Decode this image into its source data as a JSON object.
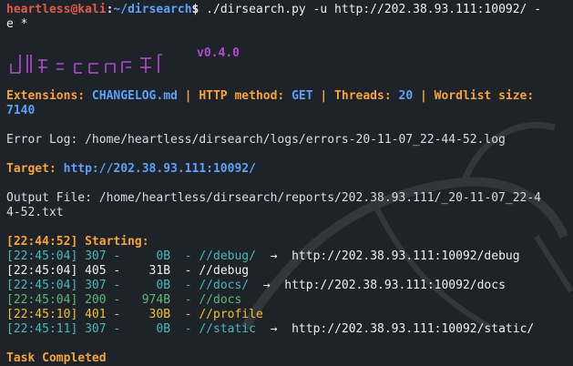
{
  "prompt": {
    "user": "heartless",
    "at": "@",
    "host": "kali",
    "colon": ":",
    "path": "~/dirsearch",
    "symbol": "$",
    "command_part1": " ./dirsearch.py -u http://202.38.93.111:10092/ -",
    "command_part2": "e *"
  },
  "banner": {
    "version": "v0.4.0"
  },
  "config": {
    "ext_label": "Extensions: ",
    "ext_value": "CHANGELOG.md",
    "sep1": " | ",
    "method_label": "HTTP method: ",
    "method_value": "GET",
    "sep2": " | ",
    "threads_label": "Threads: ",
    "threads_value": "20",
    "sep3": " | ",
    "wordlist_label": "Wordlist size:",
    "wordlist_value": "7140"
  },
  "error_log": "Error Log: /home/heartless/dirsearch/logs/errors-20-11-07_22-44-52.log",
  "target": {
    "label": "Target: ",
    "value": "http://202.38.93.111:10092/"
  },
  "output_file": {
    "line1": "Output File: /home/heartless/dirsearch/reports/202.38.93.111/_20-11-07_22-4",
    "line2": "4-52.txt"
  },
  "starting": "[22:44:52] Starting:",
  "results": [
    {
      "time": "[22:45:04]",
      "status": "307",
      "size": "0B",
      "path": "//debug/",
      "arrow": "→",
      "redirect": "http://202.38.93.111:10092/debug",
      "color": "#4cb7b8"
    },
    {
      "time": "[22:45:04]",
      "status": "405",
      "size": "31B",
      "path": "//debug",
      "arrow": "",
      "redirect": "",
      "color": "#eef0f3"
    },
    {
      "time": "[22:45:04]",
      "status": "307",
      "size": "0B",
      "path": "//docs/",
      "arrow": "→",
      "redirect": "http://202.38.93.111:10092/docs",
      "color": "#4cb7b8"
    },
    {
      "time": "[22:45:04]",
      "status": "200",
      "size": "974B",
      "path": "//docs",
      "arrow": "",
      "redirect": "",
      "color": "#5fb87a"
    },
    {
      "time": "[22:45:10]",
      "status": "401",
      "size": "30B",
      "path": "//profile",
      "arrow": "",
      "redirect": "",
      "color": "#f0c232"
    },
    {
      "time": "[22:45:11]",
      "status": "307",
      "size": "0B",
      "path": "//static",
      "arrow": "→",
      "redirect": "http://202.38.93.111:10092/static/",
      "color": "#4cb7b8"
    }
  ],
  "task_completed": "Task Completed",
  "colors": {
    "background": "#1e2229",
    "prompt_user": "#e35a49",
    "prompt_path": "#5ea1f5",
    "accent_orange": "#f6a43a",
    "banner_purple": "#b54bd5"
  }
}
